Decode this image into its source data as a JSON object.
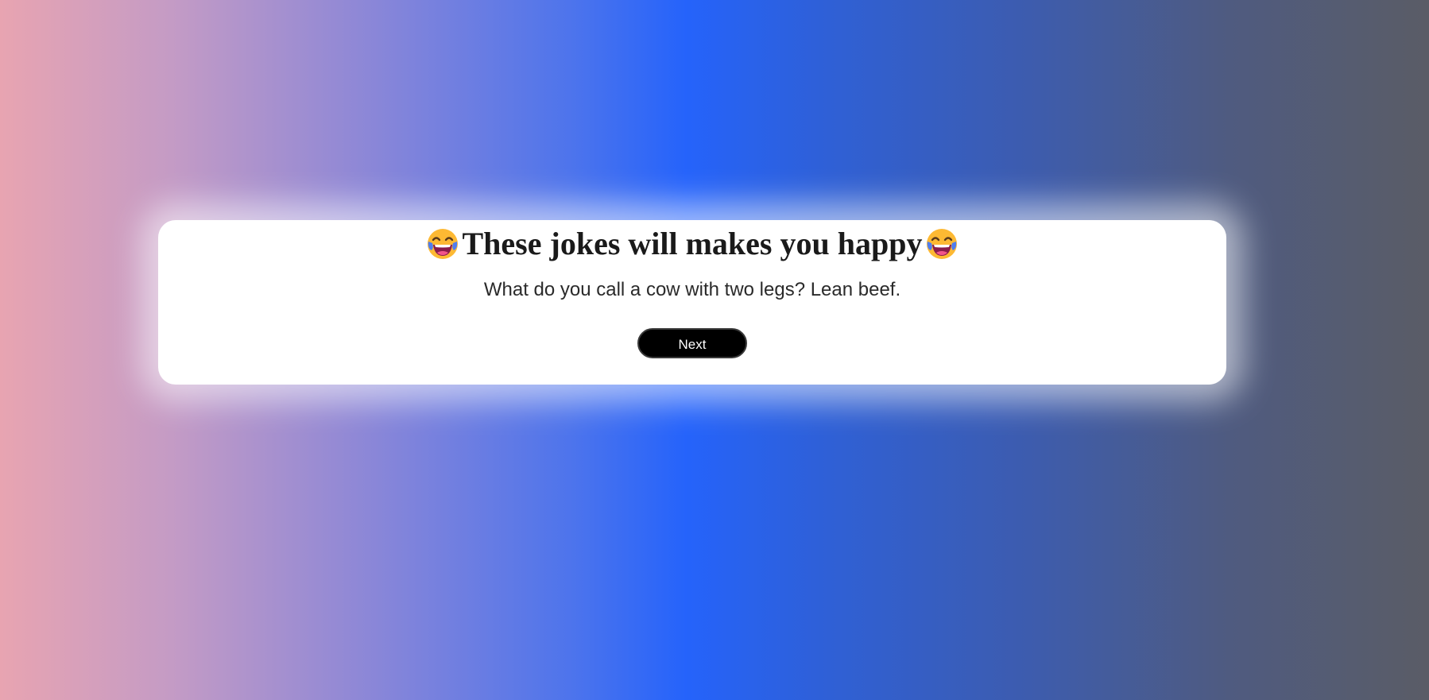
{
  "header": {
    "title": "These jokes will makes you happy",
    "emoji_icon": "face-with-tears-of-joy-icon"
  },
  "joke": {
    "text": "What do you call a cow with two legs? Lean beef."
  },
  "actions": {
    "next_label": "Next"
  },
  "colors": {
    "card_background": "#ffffff",
    "button_background": "#000000",
    "button_text": "#ffffff",
    "gradient_center": "#2563fb"
  }
}
